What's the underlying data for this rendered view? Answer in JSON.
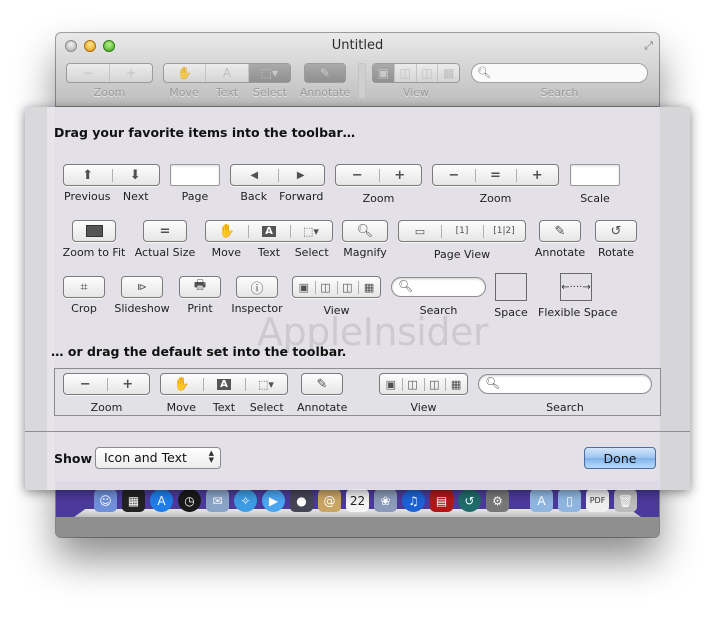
{
  "window": {
    "title": "Untitled",
    "toolbar": {
      "zoom_label": "Zoom",
      "move_label": "Move",
      "text_label": "Text",
      "select_label": "Select",
      "annotate_label": "Annotate",
      "view_label": "View",
      "search_label": "Search",
      "search_placeholder": ""
    }
  },
  "sheet": {
    "heading_favorites": "Drag your favorite items into the toolbar…",
    "heading_default": "… or drag the default set into the toolbar.",
    "watermark": "AppleInsider",
    "items_row1": {
      "previous": "Previous",
      "next": "Next",
      "page": "Page",
      "back": "Back",
      "forward": "Forward",
      "zoom": "Zoom",
      "zoom3": "Zoom",
      "scale": "Scale"
    },
    "items_row2": {
      "zoom_to_fit": "Zoom to Fit",
      "actual_size": "Actual Size",
      "move": "Move",
      "text": "Text",
      "select": "Select",
      "magnify": "Magnify",
      "page_view": "Page View",
      "annotate": "Annotate",
      "rotate": "Rotate"
    },
    "items_row3": {
      "crop": "Crop",
      "slideshow": "Slideshow",
      "print": "Print",
      "inspector": "Inspector",
      "view": "View",
      "search": "Search",
      "space": "Space",
      "flexible_space": "Flexible Space"
    },
    "default_set": {
      "zoom": "Zoom",
      "move": "Move",
      "text": "Text",
      "select": "Select",
      "annotate": "Annotate",
      "view": "View",
      "search": "Search"
    },
    "footer": {
      "show_label": "Show",
      "show_value": "Icon and Text",
      "done_label": "Done"
    }
  },
  "dock": {
    "icons": [
      "finder",
      "dashboard",
      "app-store",
      "clock",
      "mail",
      "safari",
      "facetime",
      "webcam",
      "contacts",
      "calendar",
      "iphoto",
      "itunes",
      "photo-booth",
      "time-machine",
      "system-preferences",
      "applications-folder",
      "documents-folder",
      "pdf-file",
      "trash"
    ],
    "calendar_day": "22"
  },
  "colors": {
    "done_button": "#9cc4ef",
    "dock_background": "#4b3a9a"
  }
}
